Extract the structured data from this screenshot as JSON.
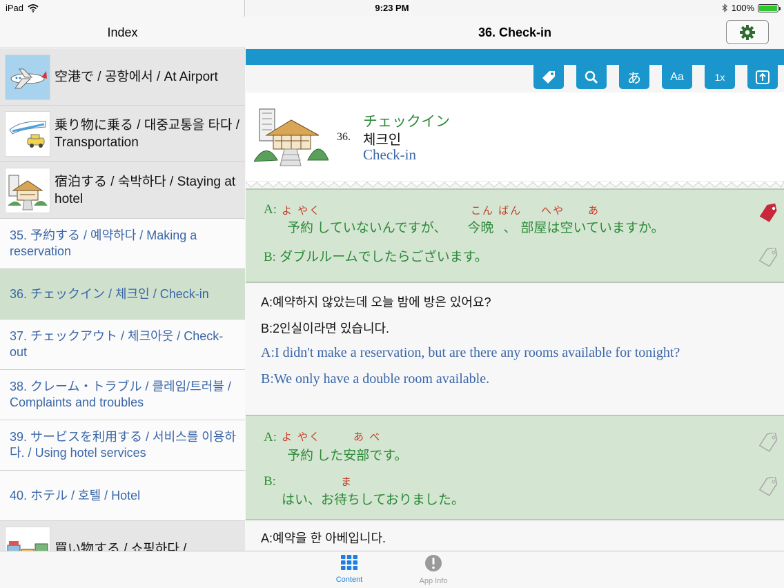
{
  "status": {
    "device": "iPad",
    "time": "9:23 PM",
    "battery": "100%"
  },
  "sidebar": {
    "title": "Index",
    "items": [
      {
        "kind": "category",
        "label": "空港で / 공항에서 / At Airport",
        "icon": "airplane-icon"
      },
      {
        "kind": "category",
        "label": "乗り物に乗る / 대중교통을 타다 / Transportation",
        "icon": "transport-icon"
      },
      {
        "kind": "category",
        "label": "宿泊する / 숙박하다 / Staying at hotel",
        "icon": "hotel-icon"
      },
      {
        "kind": "lesson",
        "label": "35. 予約する / 예약하다 / Making a reservation",
        "selected": false
      },
      {
        "kind": "lesson",
        "label": "36. チェックイン / 체크인 / Check-in",
        "selected": true
      },
      {
        "kind": "lesson",
        "label": "37. チェックアウト / 체크아웃 / Check-out",
        "selected": false
      },
      {
        "kind": "lesson",
        "label": "38. クレーム・トラブル / 클레임/트러블 / Complaints and troubles",
        "selected": false
      },
      {
        "kind": "lesson",
        "label": "39. サービスを利用する / 서비스를 이용하다. / Using hotel services",
        "selected": false
      },
      {
        "kind": "lesson",
        "label": "40. ホテル / 호텔 / Hotel",
        "selected": false
      },
      {
        "kind": "category",
        "label": "買い物する / 쇼핑하다 /",
        "icon": "shopping-icon"
      }
    ]
  },
  "nav": {
    "title": "36. Check-in",
    "settings_icon": "gear-icon"
  },
  "toolbar": {
    "buttons": [
      {
        "name": "tag-filter-button",
        "icon": "tag-icon",
        "label": ""
      },
      {
        "name": "search-button",
        "icon": "magnifier-icon",
        "label": ""
      },
      {
        "name": "furigana-button",
        "icon": "",
        "label": "あ"
      },
      {
        "name": "font-size-button",
        "icon": "",
        "label": "Aa"
      },
      {
        "name": "speed-button",
        "icon": "",
        "label": "1x"
      },
      {
        "name": "scroll-top-button",
        "icon": "arrow-up-icon",
        "label": ""
      }
    ]
  },
  "lesson": {
    "number": "36.",
    "jp": "チェックイン",
    "kr": "체크인",
    "en": "Check-in"
  },
  "dialogs": {
    "d1": {
      "a_speaker": "A:",
      "a_ruby": {
        "r1": "よ やく",
        "r2": "こん ばん",
        "r3": "へや",
        "r4": "あ"
      },
      "a_parts": {
        "p1": "予約",
        "p2": " していないんですが、",
        "p3": "今晩",
        "p4": "、",
        "p5": "部屋",
        "p6": "は",
        "p7": "空",
        "p8": "いていますか。"
      },
      "b_speaker": "B:",
      "b_text": "ダブルルームでしたらございます。",
      "tr_kr_a": "A:예약하지 않았는데 오늘 밤에 방은 있어요?",
      "tr_kr_b": "B:2인실이라면 있습니다.",
      "tr_en_a": "A:I didn't make a reservation, but are there any rooms available for tonight?",
      "tr_en_b": "B:We only have a double room available."
    },
    "d2": {
      "a_speaker": "A:",
      "a_ruby": {
        "r1": "よ やく",
        "r2": "あ べ"
      },
      "a_parts": {
        "p1": "予約",
        "p2": " した",
        "p3": "安部",
        "p4": "です。"
      },
      "b_speaker": "B:",
      "b_ruby": {
        "r1": "ま"
      },
      "b_parts": {
        "p1": "はい、お",
        "p2": "待",
        "p3": "ちしておりました。"
      },
      "tr_kr_a": "A:예약을 한 아베입니다."
    }
  },
  "tabs": [
    {
      "label": "Content",
      "icon": "grid-icon",
      "active": true
    },
    {
      "label": "App Info",
      "icon": "info-icon",
      "active": false
    }
  ],
  "colors": {
    "accent": "#1a96cc",
    "green_text": "#2d8a3a",
    "blue_text": "#3a66a8",
    "ruby_red": "#c63c2a",
    "card_green": "#d4e6d1",
    "tab_active": "#1f7fe0"
  }
}
